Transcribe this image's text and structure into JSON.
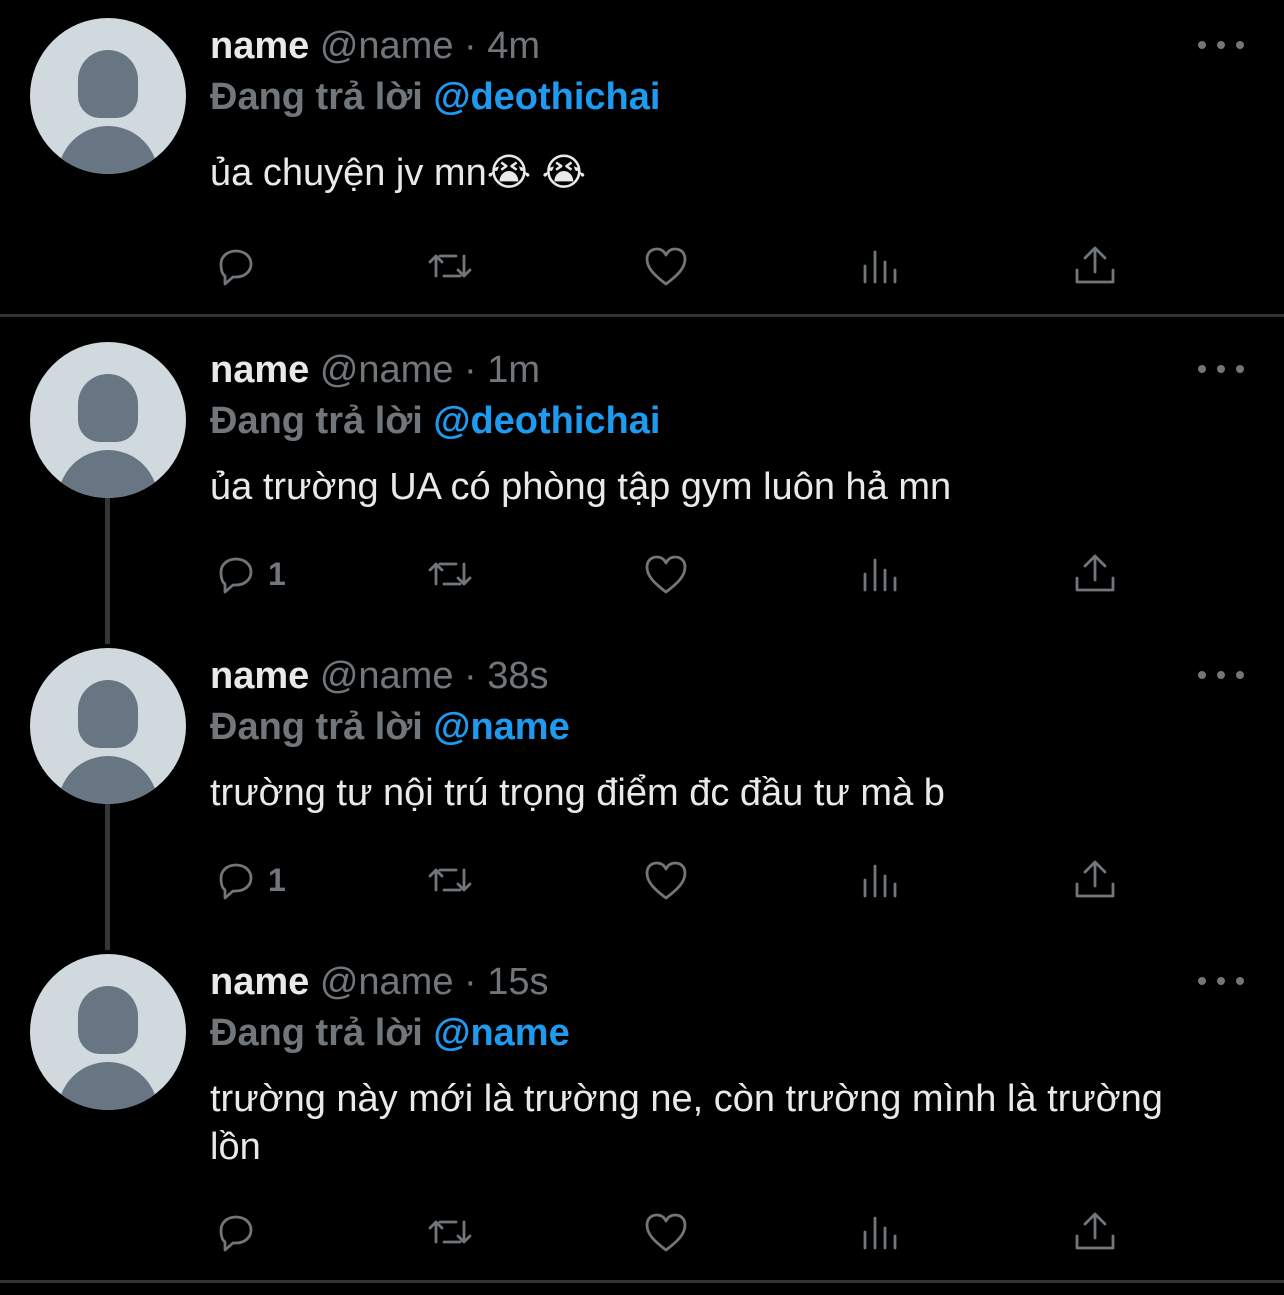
{
  "tweets": [
    {
      "name": "name",
      "handle": "@name",
      "sep": "·",
      "time": "4m",
      "reply_prefix": "Đang trả lời",
      "reply_to": "@deothichai",
      "text": "ủa chuyện jv mn😭 😭",
      "reply_count": ""
    },
    {
      "name": "name",
      "handle": "@name",
      "sep": "·",
      "time": "1m",
      "reply_prefix": "Đang trả lời",
      "reply_to": "@deothichai",
      "text": "ủa trường UA có phòng tập gym luôn hả mn",
      "reply_count": "1"
    },
    {
      "name": "name",
      "handle": "@name",
      "sep": "·",
      "time": "38s",
      "reply_prefix": "Đang trả lời",
      "reply_to": "@name",
      "text": "trường tư nội trú trọng điểm đc đầu tư mà b",
      "reply_count": "1"
    },
    {
      "name": "name",
      "handle": "@name",
      "sep": "·",
      "time": "15s",
      "reply_prefix": "Đang trả lời",
      "reply_to": "@name",
      "text": "trường này mới là trường ne, còn trường mình là trường lồn",
      "reply_count": ""
    }
  ],
  "colors": {
    "background": "#000000",
    "text": "#e7e9ea",
    "muted": "#71767b",
    "accent": "#1d9bf0"
  },
  "icons": [
    "more-icon",
    "reply-icon",
    "retweet-icon",
    "like-icon",
    "analytics-icon",
    "share-icon"
  ]
}
